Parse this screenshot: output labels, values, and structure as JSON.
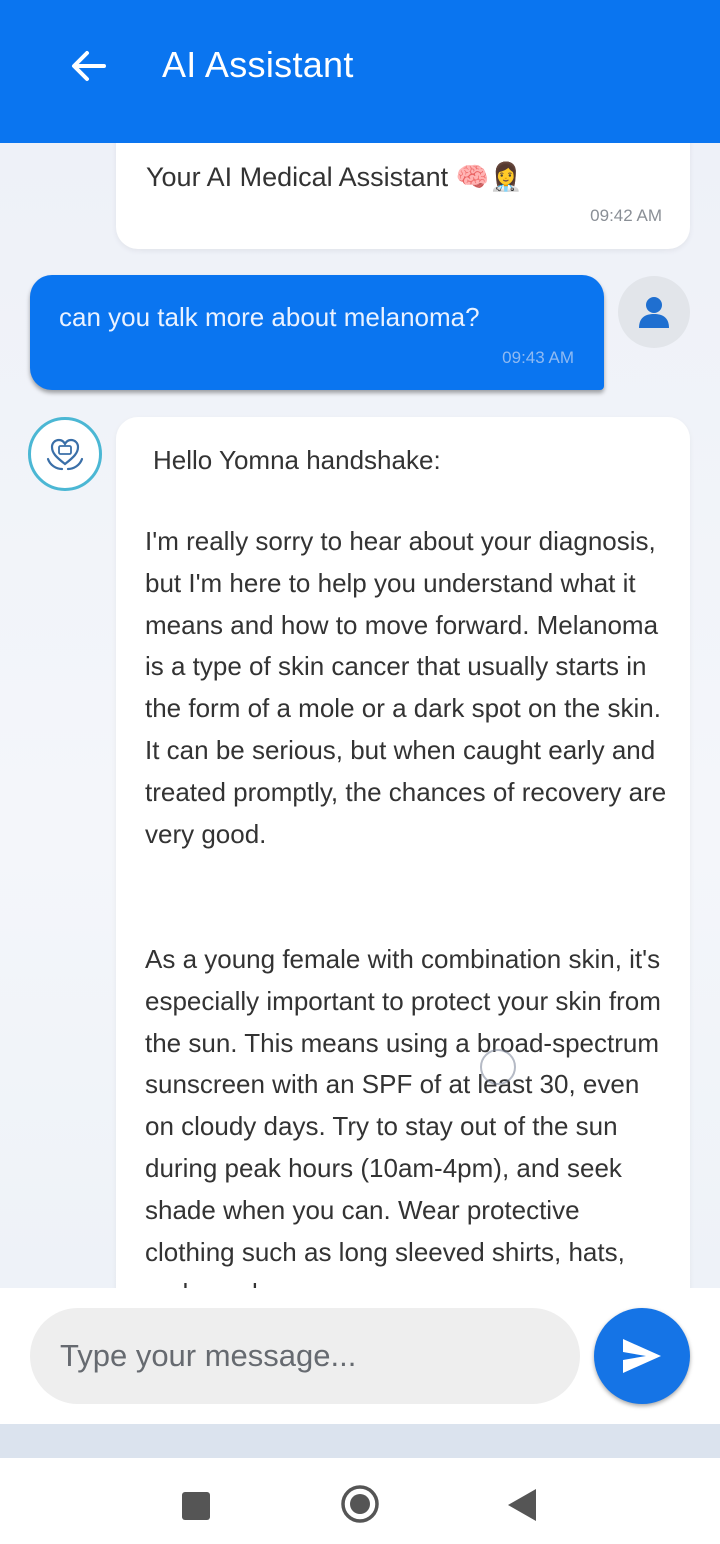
{
  "app_bar": {
    "title": "AI Assistant",
    "back_icon": "arrow-left-icon",
    "color": "#0a75f0"
  },
  "messages": [
    {
      "sender": "bot",
      "text": "Your AI Medical Assistant 🧠👩‍⚕️",
      "time": "09:42 AM"
    },
    {
      "sender": "user",
      "text": "can you talk more about melanoma?",
      "time": "09:43 AM",
      "avatar_icon": "user-icon"
    },
    {
      "sender": "bot",
      "avatar_icon": "medical-heart-hands-icon",
      "greeting": "Hello Yomna  handshake:",
      "paragraphs": [
        "I'm really sorry to hear about your diagnosis, but I'm here to help you understand what it means and how to move forward. Melanoma is a type of skin cancer that usually starts in the form of a mole or a dark spot on the skin. It can be serious, but when caught early and treated promptly, the chances of recovery are very good.",
        "As a young female with combination skin, it's especially important to protect your skin from the sun. This means using a broad-spectrum sunscreen with an SPF of at least 30, even on cloudy days. Try to stay out of the sun during peak hours (10am-4pm), and seek shade when you can. Wear protective clothing such as long sleeved shirts, hats, and sunglasses"
      ]
    }
  ],
  "input": {
    "placeholder": "Type your message...",
    "value": ""
  },
  "send_button": {
    "icon": "send-icon",
    "color": "#1574e6"
  },
  "system_nav": {
    "recents_icon": "square-icon",
    "home_icon": "circle-icon",
    "back_icon": "triangle-back-icon"
  }
}
